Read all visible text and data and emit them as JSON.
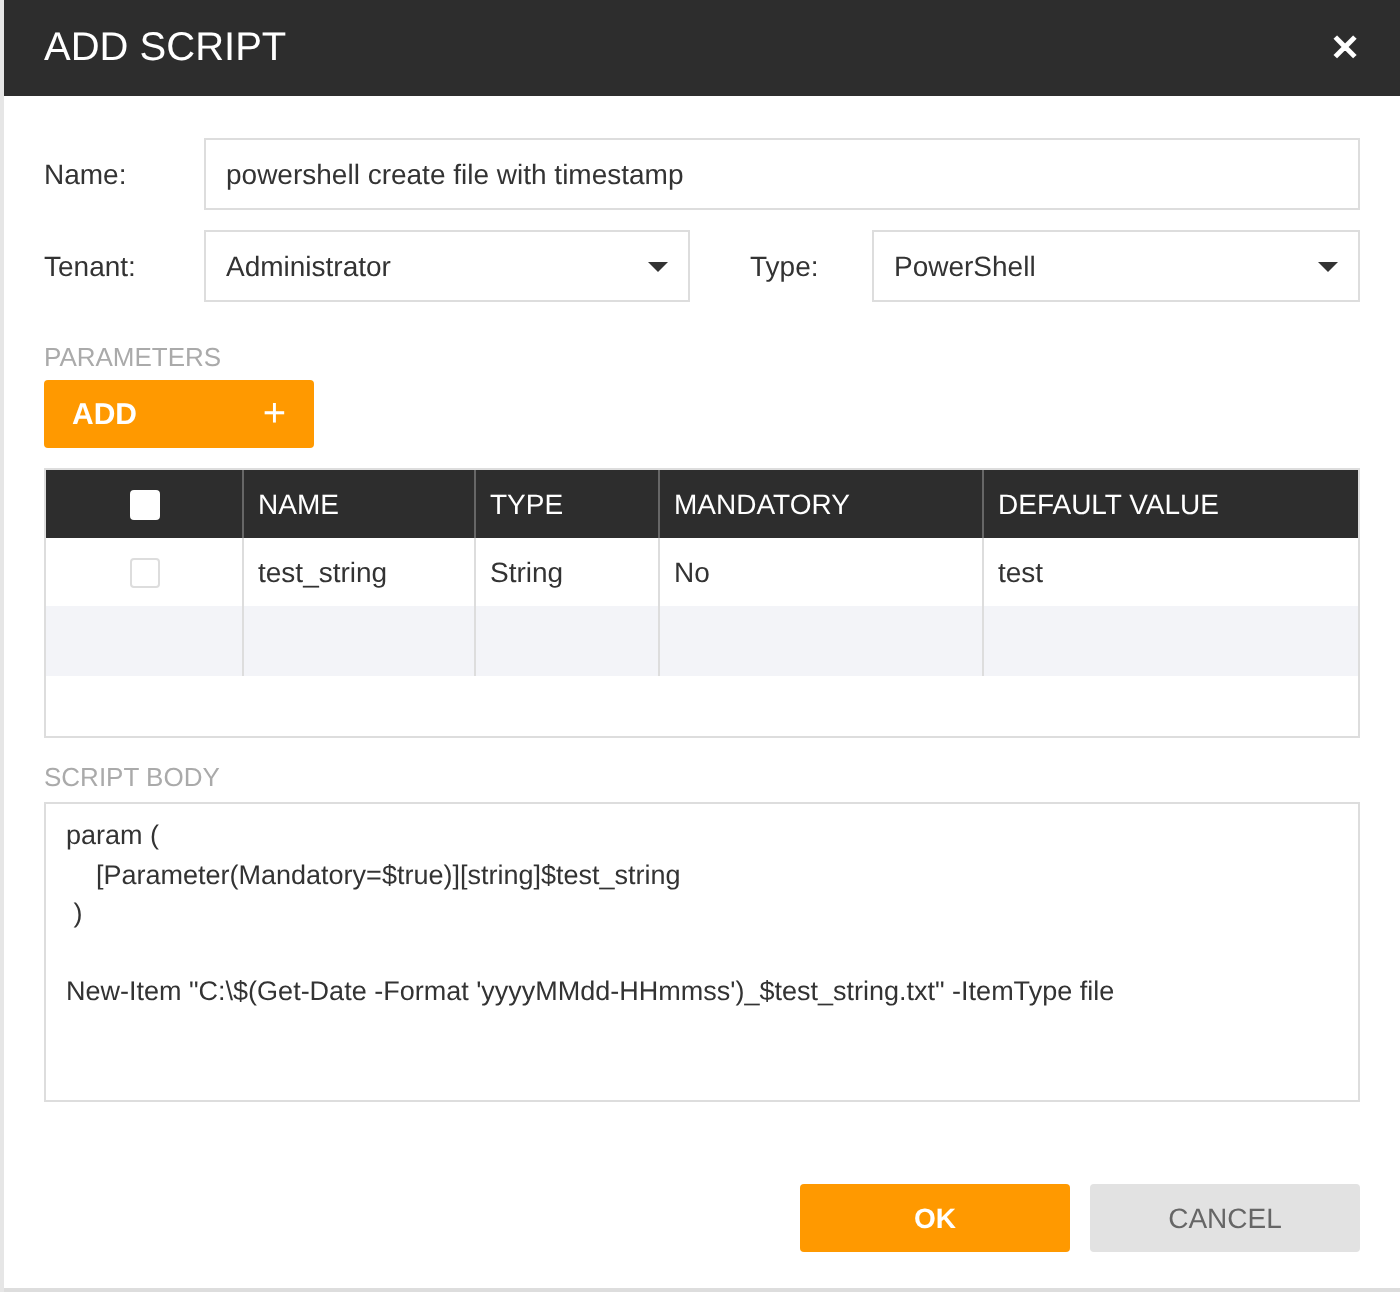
{
  "dialog": {
    "title": "ADD SCRIPT",
    "close": "✕"
  },
  "fields": [
    {
      "label": "Name:",
      "value": "powershell create file with timestamp",
      "kind": "text"
    }
  ],
  "selects": [
    {
      "label": "Tenant:",
      "value": "Administrator"
    },
    {
      "label": "Type:",
      "value": "PowerShell"
    }
  ],
  "parameters": {
    "heading": "PARAMETERS",
    "add_button": {
      "label": "ADD",
      "icon": "+"
    },
    "table": {
      "select_all": {
        "checked": false
      },
      "columns": [
        "NAME",
        "TYPE",
        "MANDATORY",
        "DEFAULT VALUE"
      ],
      "rows": [
        {
          "checked": false,
          "cells": [
            "test_string",
            "String",
            "No",
            "test"
          ]
        }
      ]
    }
  },
  "script_body": {
    "heading": "SCRIPT BODY",
    "blocks": [
      [
        "param (",
        "    [Parameter(Mandatory=$true)][string]$test_string",
        " )"
      ],
      [
        "New-Item \"C:\\$(Get-Date -Format 'yyyyMMdd-HHmmss')_$test_string.txt\" -ItemType file"
      ]
    ]
  },
  "buttons": [
    {
      "label": "OK",
      "kind": "primary"
    },
    {
      "label": "CANCEL",
      "kind": "secondary"
    }
  ]
}
